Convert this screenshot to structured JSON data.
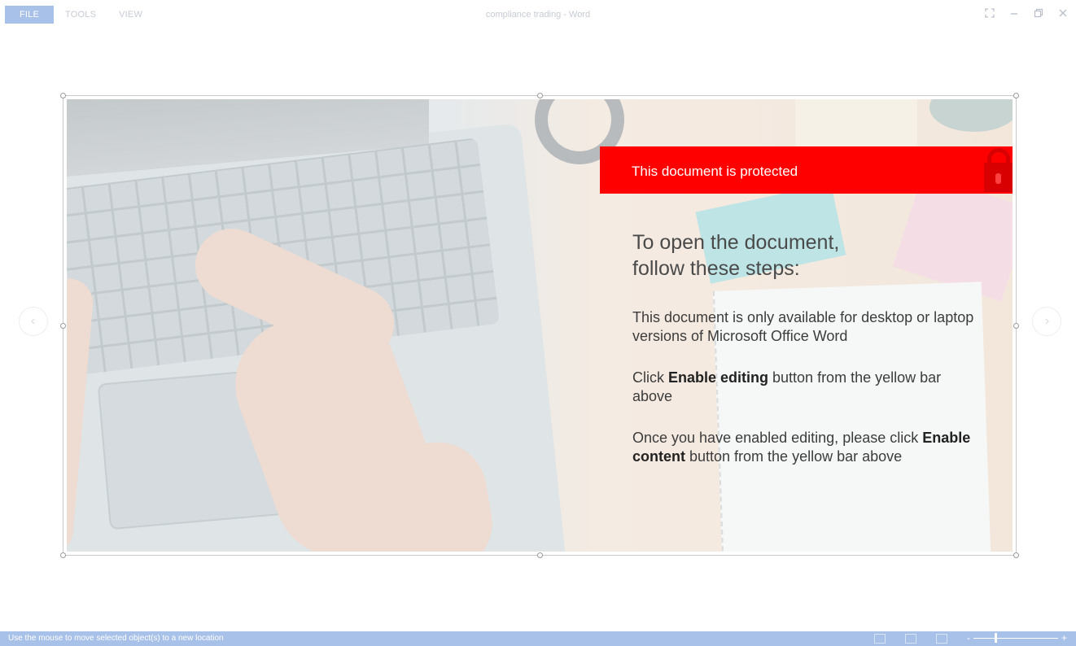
{
  "menu": [
    {
      "label": "FILE",
      "active": true
    },
    {
      "label": "TOOLS",
      "active": false
    },
    {
      "label": "VIEW",
      "active": false
    }
  ],
  "window_title": "compliance trading - Word",
  "window_controls": {
    "fullscreen_icon": "fullscreen-icon",
    "minimize_icon": "minimize-icon",
    "restore_icon": "restore-icon",
    "close_icon": "close-icon"
  },
  "banner": {
    "text": "This document is protected",
    "color": "#ff0000",
    "icon": "lock-icon"
  },
  "instructions": {
    "heading": "To open the document, follow these steps:",
    "step1": "This document is only available for desktop or laptop versions of Microsoft Office Word",
    "step2_prefix": "Click ",
    "step2_bold": "Enable editing",
    "step2_suffix": " button from the yellow bar above",
    "step3_prefix": "Once you have enabled editing, please click ",
    "step3_bold": "Enable content",
    "step3_suffix": " button from the yellow bar above"
  },
  "statusbar": {
    "text": "Use the mouse to move selected object(s) to a new location",
    "zoom_minus": "-",
    "zoom_plus": "+",
    "zoom_level": 0.25,
    "accent": "#a8c1e8"
  }
}
